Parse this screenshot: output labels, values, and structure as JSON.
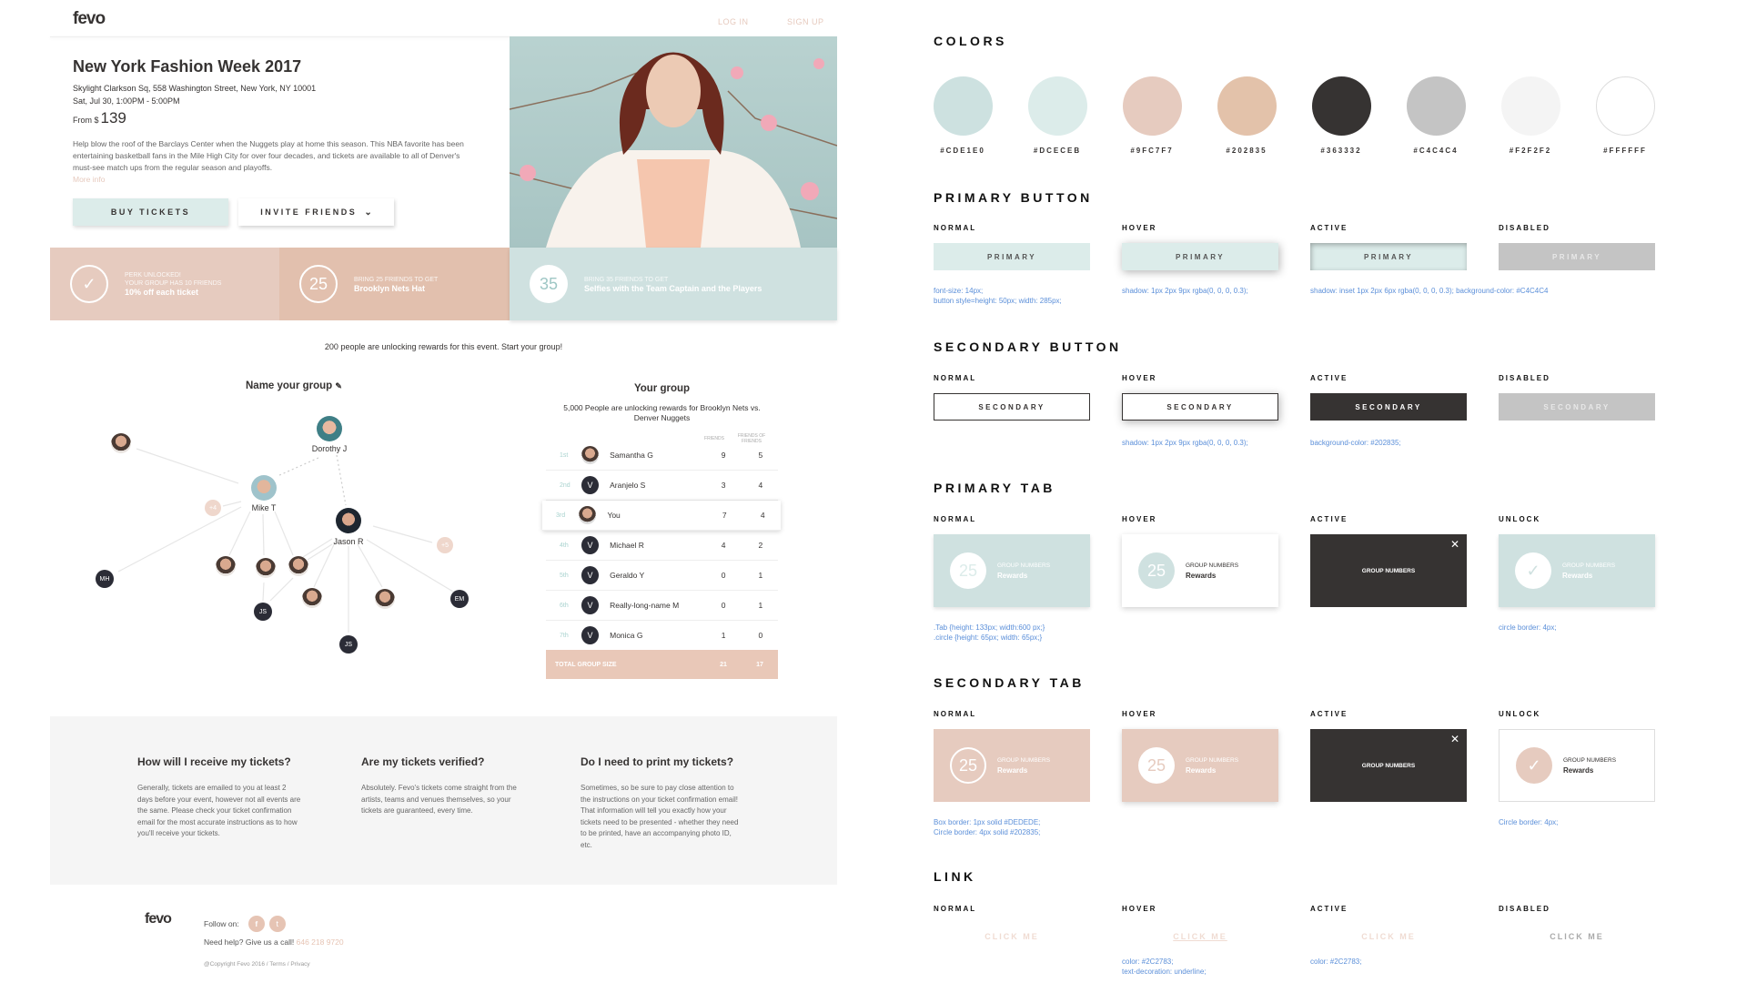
{
  "header": {
    "logo": "fevo",
    "login": "LOG IN",
    "signup": "SIGN UP"
  },
  "event": {
    "title": "New York Fashion Week 2017",
    "address": "Skylight Clarkson Sq, 558 Washington Street, New York, NY 10001",
    "datetime": "Sat, Jul 30, 1:00PM - 5:00PM",
    "from_label": "From $",
    "price": "139",
    "description": "Help blow the roof of the Barclays Center when the Nuggets play at home this season. This NBA favorite has been entertaining basketball fans in the Mile High City for over four decades, and tickets are available to all of Denver's must-see match ups from the regular season and playoffs.",
    "more_info": "More info",
    "buy_label": "BUY TICKETS",
    "invite_label": "INVITE FRIENDS"
  },
  "tiers": [
    {
      "circle": "✓",
      "small1": "PERK UNLOCKED!",
      "small2": "YOUR GROUP HAS 10 FRIENDS",
      "big": "10% off each ticket"
    },
    {
      "circle": "25",
      "small1": "BRING 25 FRIENDS TO GET",
      "big": "Brooklyn Nets Hat"
    },
    {
      "circle": "35",
      "small1": "BRING 35 FRIENDS TO GET",
      "big": "Selfies with the Team Captain and the Players"
    }
  ],
  "unlocking_text": "200 people are unlocking rewards for this event. Start your group!",
  "network": {
    "title": "Name your group",
    "nodes": {
      "dorothy": "Dorothy J",
      "mike": "Mike T",
      "jason": "Jason R",
      "mh": "MH",
      "js1": "JS",
      "js2": "JS",
      "em": "EM",
      "plus1": "+4",
      "plus2": "+5"
    }
  },
  "group": {
    "title": "Your group",
    "subtitle": "5,000 People are unlocking rewards for Brooklyn Nets vs. Denver Nuggets",
    "col_friends": "FRIENDS",
    "col_fof": "FRIENDS OF FRIENDS",
    "rows": [
      {
        "rank": "1st",
        "name": "Samantha G",
        "friends": "9",
        "fof": "5",
        "avatar": "photo"
      },
      {
        "rank": "2nd",
        "name": "Aranjelo S",
        "friends": "3",
        "fof": "4",
        "avatar": "V"
      },
      {
        "rank": "3rd",
        "name": "You",
        "friends": "7",
        "fof": "4",
        "avatar": "photo"
      },
      {
        "rank": "4th",
        "name": "Michael R",
        "friends": "4",
        "fof": "2",
        "avatar": "V"
      },
      {
        "rank": "5th",
        "name": "Geraldo Y",
        "friends": "0",
        "fof": "1",
        "avatar": "V"
      },
      {
        "rank": "6th",
        "name": "Really-long-name M",
        "friends": "0",
        "fof": "1",
        "avatar": "V"
      },
      {
        "rank": "7th",
        "name": "Monica G",
        "friends": "1",
        "fof": "0",
        "avatar": "V"
      }
    ],
    "total_label": "TOTAL GROUP SIZE",
    "total_friends": "21",
    "total_fof": "17"
  },
  "faq": [
    {
      "q": "How will I receive my tickets?",
      "a": "Generally, tickets are emailed to you at least 2 days before your event, however not all events are the same. Please check your ticket confirmation email for the most accurate instructions as to how you'll receive your tickets."
    },
    {
      "q": "Are my tickets verified?",
      "a": "Absolutely. Fevo's tickets come straight from the artists, teams and venues themselves, so your tickets are guaranteed, every time."
    },
    {
      "q": "Do I need to print my tickets?",
      "a": "Sometimes, so be sure to pay close attention to the instructions on your ticket confirmation email! That information will tell you exactly how your tickets need to be presented - whether they need to be printed, have an accompanying photo ID, etc."
    }
  ],
  "footer": {
    "logo": "fevo",
    "follow": "Follow on:",
    "help": "Need help? Give us a call!",
    "phone": "646 218 9720",
    "copyright": "@Copyright Fevo 2016 / Terms / Privacy",
    "social_icons": [
      "facebook-icon",
      "twitter-icon"
    ]
  },
  "style": {
    "colors_title": "COLORS",
    "colors": [
      "#CDE1E0",
      "#DCECEB",
      "#9FC7F7",
      "#202835",
      "#363332",
      "#C4C4C4",
      "#F2F2F2",
      "#FFFFFF"
    ],
    "swatch_fills": [
      "#cde1e0",
      "#dcecea",
      "#e6cbbf",
      "#e3c2aa",
      "#363332",
      "#c4c4c4",
      "#f4f4f4",
      "#ffffff"
    ],
    "states4": [
      "NORMAL",
      "HOVER",
      "ACTIVE",
      "DISABLED"
    ],
    "states_tab": [
      "NORMAL",
      "HOVER",
      "ACTIVE",
      "UNLOCK"
    ],
    "primary_button": {
      "title": "PRIMARY BUTTON",
      "label": "PRIMARY",
      "note_normal": "font-size: 14px;\nbutton style=height: 50px; width: 285px;",
      "note_hover": "shadow: 1px 2px 9px rgba(0, 0, 0, 0.3);",
      "note_active": "shadow: inset 1px 2px 6px rgba(0, 0, 0, 0.3); background-color: #C4C4C4"
    },
    "secondary_button": {
      "title": "SECONDARY BUTTON",
      "label": "SECONDARY",
      "note_hover": "shadow: 1px 2px 9px rgba(0, 0, 0, 0.3);",
      "note_active": "background-color: #202835;"
    },
    "primary_tab": {
      "title": "PRIMARY TAB",
      "num": "25",
      "t1": "GROUP NUMBERS",
      "t2": "Rewards",
      "note_normal": ".Tab {height: 133px; width:600 px;}\n.circle {height: 65px; width: 65px;}",
      "note_unlock": "circle border: 4px;"
    },
    "secondary_tab": {
      "title": "SECONDARY TAB",
      "num": "25",
      "t1": "GROUP NUMBERS",
      "t2": "Rewards",
      "note_normal": "Box border: 1px solid #DEDEDE;\nCircle border: 4px solid #202835;",
      "note_unlock": "Circle border: 4px;"
    },
    "link": {
      "title": "LINK",
      "label": "CLICK ME",
      "note_hover": "color: #2C2783;\ntext-decoration: underline;",
      "note_active": "color: #2C2783;"
    }
  }
}
